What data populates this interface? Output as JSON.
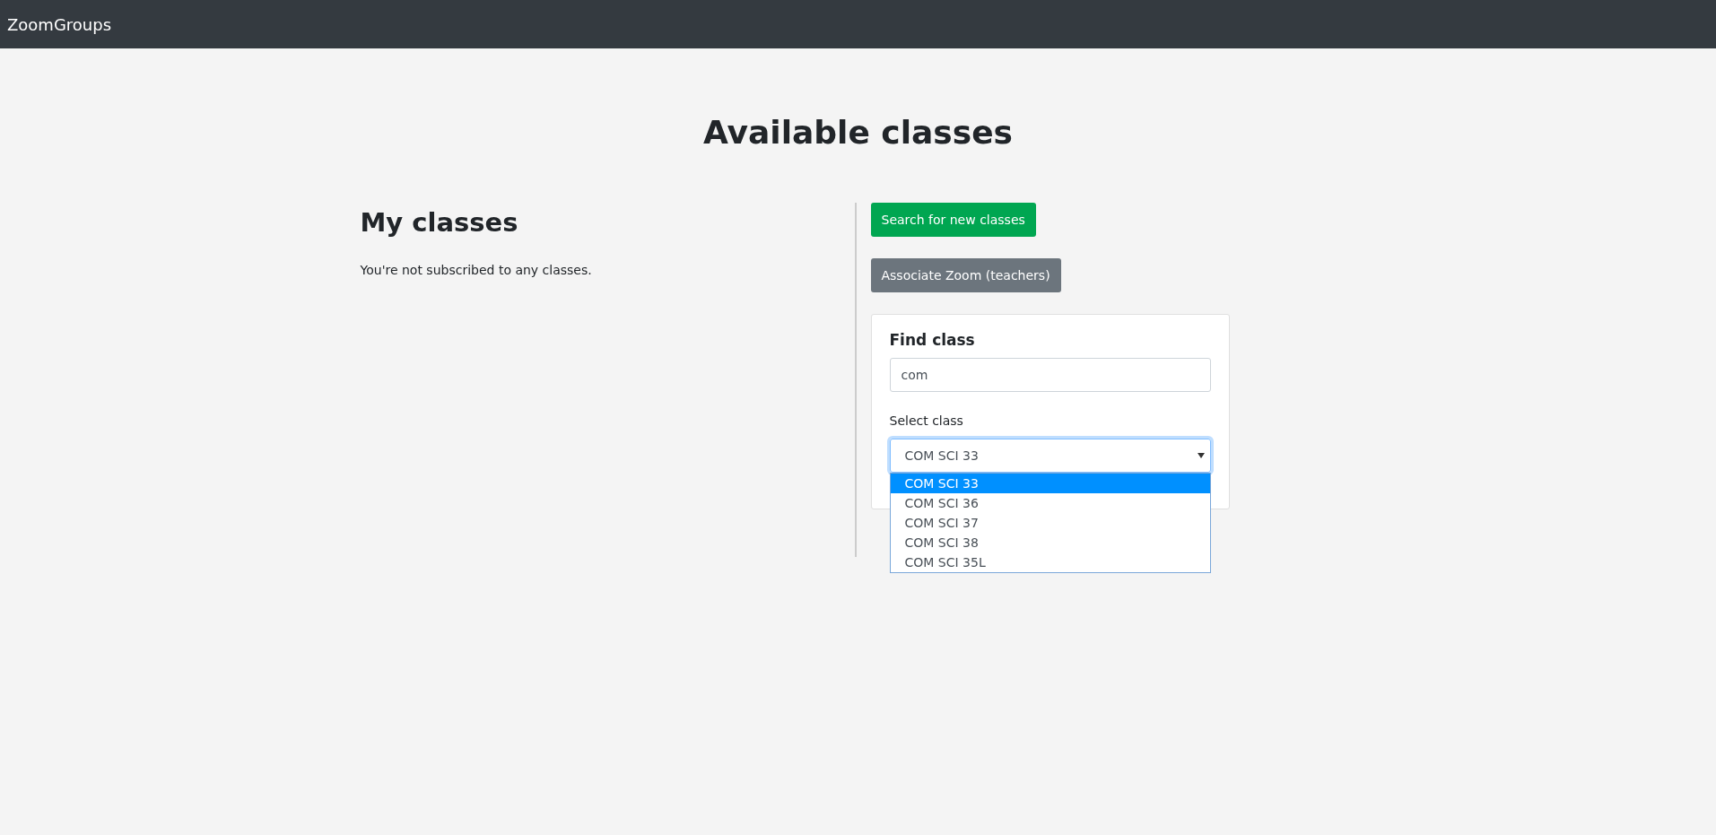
{
  "navbar": {
    "brand": "ZoomGroups"
  },
  "page_title": "Available classes",
  "my_classes": {
    "heading": "My classes",
    "message": "You're not subscribed to any classes."
  },
  "buttons": [
    {
      "label": "Search for new classes",
      "kind": "success"
    },
    {
      "label": "Associate Zoom (teachers)",
      "kind": "secondary"
    }
  ],
  "find_class": {
    "title": "Find class",
    "search": {
      "value": "com"
    },
    "select_label": "Select class",
    "select": {
      "value": "COM SCI 33",
      "expanded": true,
      "options": [
        {
          "label": "COM SCI 33",
          "selected": true
        },
        {
          "label": "COM SCI 36",
          "selected": false
        },
        {
          "label": "COM SCI 37",
          "selected": false
        },
        {
          "label": "COM SCI 38",
          "selected": false
        },
        {
          "label": "COM SCI 35L",
          "selected": false
        }
      ]
    }
  }
}
